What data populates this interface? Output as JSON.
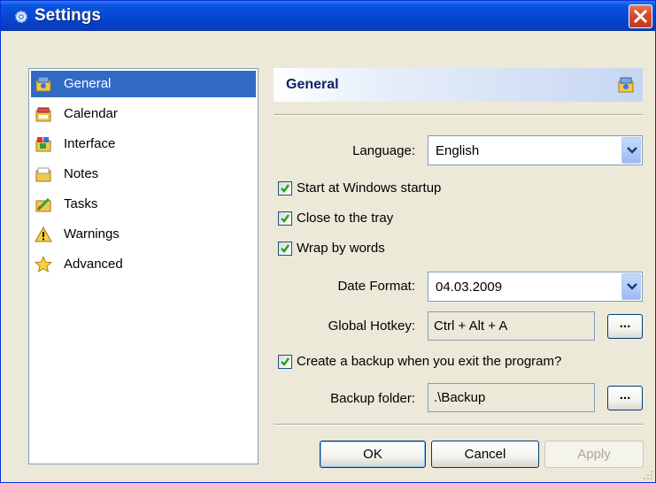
{
  "window": {
    "title": "Settings",
    "close_label": "X"
  },
  "nav": {
    "items": [
      {
        "label": "General",
        "icon": "general-icon",
        "selected": true
      },
      {
        "label": "Calendar",
        "icon": "calendar-icon",
        "selected": false
      },
      {
        "label": "Interface",
        "icon": "interface-icon",
        "selected": false
      },
      {
        "label": "Notes",
        "icon": "notes-icon",
        "selected": false
      },
      {
        "label": "Tasks",
        "icon": "tasks-icon",
        "selected": false
      },
      {
        "label": "Warnings",
        "icon": "warning-icon",
        "selected": false
      },
      {
        "label": "Advanced",
        "icon": "star-icon",
        "selected": false
      }
    ]
  },
  "panel": {
    "title": "General",
    "language": {
      "label": "Language:",
      "value": "English"
    },
    "start_at_startup": {
      "label": "Start at Windows startup",
      "checked": true
    },
    "close_to_tray": {
      "label": "Close to the tray",
      "checked": true
    },
    "wrap_by_words": {
      "label": "Wrap by words",
      "checked": true
    },
    "date_format": {
      "label": "Date Format:",
      "value": "04.03.2009"
    },
    "global_hotkey": {
      "label": "Global Hotkey:",
      "value": "Ctrl + Alt + A",
      "button_label": "..."
    },
    "create_backup": {
      "label": "Create a backup when you exit the program?",
      "checked": true
    },
    "backup_folder": {
      "label": "Backup folder:",
      "value": ".\\Backup",
      "button_label": "..."
    }
  },
  "buttons": {
    "ok": "OK",
    "cancel": "Cancel",
    "apply": "Apply",
    "apply_enabled": false
  },
  "colors": {
    "titlebar": "#0a55e0",
    "selection": "#316ac5",
    "panel_header_title": "#0d2468"
  }
}
